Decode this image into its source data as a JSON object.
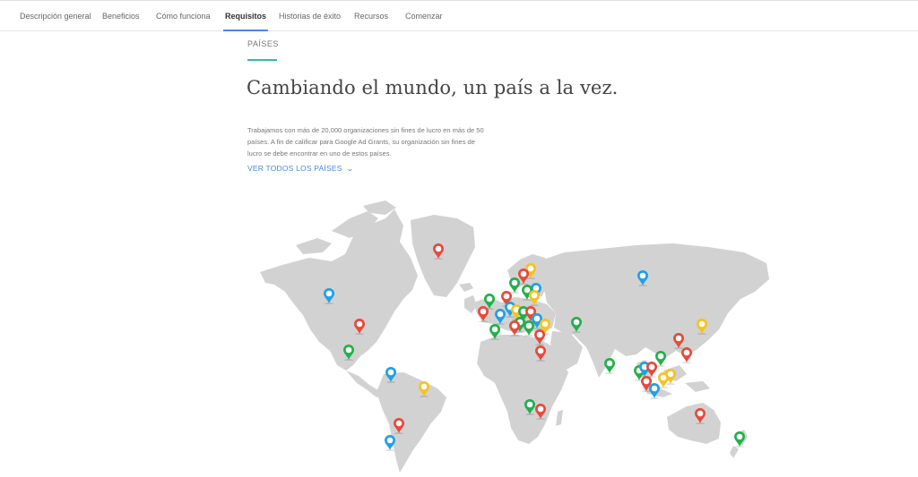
{
  "nav": {
    "tabs": [
      {
        "label": "Descripción general",
        "active": false
      },
      {
        "label": "Beneficios",
        "active": false
      },
      {
        "label": "Cómo funciona",
        "active": false
      },
      {
        "label": "Requisitos",
        "active": true
      },
      {
        "label": "Historias de éxito",
        "active": false
      },
      {
        "label": "Recursos",
        "active": false
      },
      {
        "label": "Comenzar",
        "active": false
      }
    ],
    "active_color": "#4a86e8"
  },
  "section": {
    "label": "PAÍSES",
    "rule_color": "#35b8b0",
    "title": "Cambiando el mundo, un país a la vez.",
    "body": "Trabajamos con más de 20,000 organizaciones sin fines de lucro en más de 50 países. A fin de calificar para Google Ad Grants, su organización sin fines de lucro se debe encontrar en uno de estos países.",
    "link_label": "VER TODOS LOS PAÍSES",
    "link_icon": "chevron-down-icon"
  },
  "map": {
    "land_color": "#d2d2d2",
    "pin_colors": {
      "red": "#e8493a",
      "green": "#22b04b",
      "yellow": "#f8c21c",
      "blue": "#1ea1e6"
    }
  }
}
